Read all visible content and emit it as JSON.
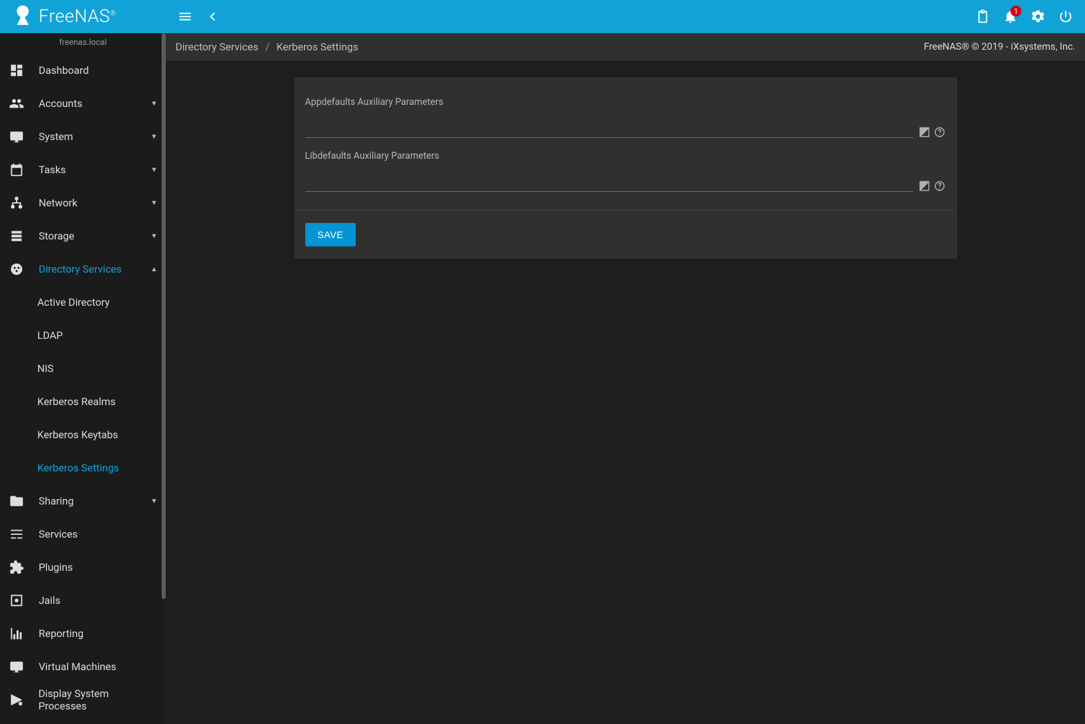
{
  "brand": {
    "name": "FreeNAS",
    "host": "freenas.local"
  },
  "topbar": {
    "notification_count": "1"
  },
  "breadcrumb": {
    "root": "Directory Services",
    "current": "Kerberos Settings"
  },
  "copyright": "FreeNAS® © 2019 - iXsystems, Inc.",
  "sidebar": {
    "items": [
      {
        "label": "Dashboard"
      },
      {
        "label": "Accounts"
      },
      {
        "label": "System"
      },
      {
        "label": "Tasks"
      },
      {
        "label": "Network"
      },
      {
        "label": "Storage"
      },
      {
        "label": "Directory Services"
      },
      {
        "label": "Sharing"
      },
      {
        "label": "Services"
      },
      {
        "label": "Plugins"
      },
      {
        "label": "Jails"
      },
      {
        "label": "Reporting"
      },
      {
        "label": "Virtual Machines"
      },
      {
        "label": "Display System Processes"
      }
    ],
    "dir_services_children": [
      {
        "label": "Active Directory"
      },
      {
        "label": "LDAP"
      },
      {
        "label": "NIS"
      },
      {
        "label": "Kerberos Realms"
      },
      {
        "label": "Kerberos Keytabs"
      },
      {
        "label": "Kerberos Settings"
      }
    ]
  },
  "form": {
    "field1": {
      "label": "Appdefaults Auxiliary Parameters",
      "value": ""
    },
    "field2": {
      "label": "Libdefaults Auxiliary Parameters",
      "value": ""
    },
    "save_label": "SAVE"
  }
}
